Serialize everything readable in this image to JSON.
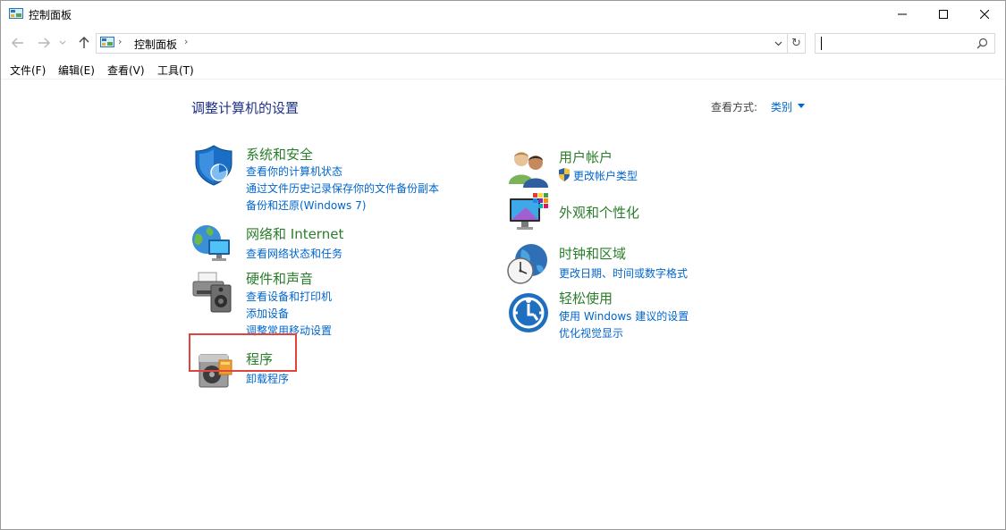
{
  "window": {
    "title": "控制面板"
  },
  "nav": {
    "address_path": "控制面板",
    "refresh_glyph": "↻"
  },
  "menu": [
    {
      "label": "文件(F)"
    },
    {
      "label": "编辑(E)"
    },
    {
      "label": "查看(V)"
    },
    {
      "label": "工具(T)"
    }
  ],
  "content": {
    "title": "调整计算机的设置",
    "view_by_label": "查看方式:",
    "view_by_value": "类别"
  },
  "categories": [
    {
      "title": "系统和安全",
      "icon": "shield-icon",
      "links": [
        "查看你的计算机状态",
        "通过文件历史记录保存你的文件备份副本",
        "备份和还原(Windows 7)"
      ]
    },
    {
      "title": "网络和 Internet",
      "icon": "network-globe-icon",
      "links": [
        "查看网络状态和任务"
      ]
    },
    {
      "title": "硬件和声音",
      "icon": "printer-speaker-icon",
      "links": [
        "查看设备和打印机",
        "添加设备",
        "调整常用移动设置"
      ]
    },
    {
      "title": "程序",
      "icon": "programs-disc-icon",
      "links": [
        "卸载程序"
      ]
    },
    {
      "title": "用户帐户",
      "icon": "users-icon",
      "links": [
        "更改帐户类型"
      ]
    },
    {
      "title": "外观和个性化",
      "icon": "monitor-colors-icon",
      "links": []
    },
    {
      "title": "时钟和区域",
      "icon": "clock-globe-icon",
      "links": [
        "更改日期、时间或数字格式"
      ]
    },
    {
      "title": "轻松使用",
      "icon": "accessibility-icon",
      "links": [
        "使用 Windows 建议的设置",
        "优化视觉显示"
      ]
    }
  ],
  "colors": {
    "category_title": "#2a7d2a",
    "link": "#0066cc",
    "page_title": "#1e3287",
    "highlight": "#e0443e"
  }
}
